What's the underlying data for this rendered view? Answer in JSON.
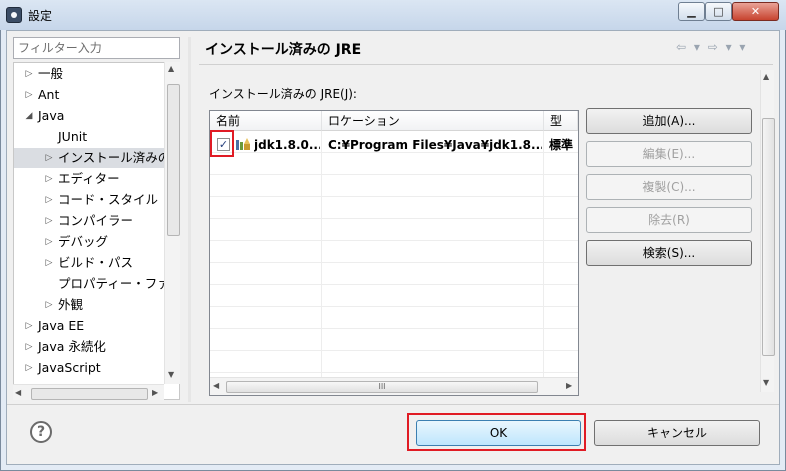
{
  "window": {
    "title": "設定"
  },
  "left": {
    "filter_placeholder": "フィルター入力",
    "tree": [
      {
        "label": "一般",
        "twisty": "▷",
        "level": 0
      },
      {
        "label": "Ant",
        "twisty": "▷",
        "level": 0
      },
      {
        "label": "Java",
        "twisty": "◢",
        "level": 0
      },
      {
        "label": "JUnit",
        "twisty": "",
        "level": 1
      },
      {
        "label": "インストール済みの",
        "twisty": "▷",
        "level": 1,
        "selected": true
      },
      {
        "label": "エディター",
        "twisty": "▷",
        "level": 1
      },
      {
        "label": "コード・スタイル",
        "twisty": "▷",
        "level": 1
      },
      {
        "label": "コンパイラー",
        "twisty": "▷",
        "level": 1
      },
      {
        "label": "デバッグ",
        "twisty": "▷",
        "level": 1
      },
      {
        "label": "ビルド・パス",
        "twisty": "▷",
        "level": 1
      },
      {
        "label": "プロパティー・ファ",
        "twisty": "",
        "level": 1
      },
      {
        "label": "外観",
        "twisty": "▷",
        "level": 1
      },
      {
        "label": "Java EE",
        "twisty": "▷",
        "level": 0
      },
      {
        "label": "Java 永続化",
        "twisty": "▷",
        "level": 0
      },
      {
        "label": "JavaScript",
        "twisty": "▷",
        "level": 0
      }
    ]
  },
  "page": {
    "title": "インストール済みの JRE",
    "nav": "⇦ ▾ ⇨ ▾ ▾",
    "jre_label": "インストール済みの JRE(J):",
    "table": {
      "headers": [
        "名前",
        "ロケーション",
        "型"
      ],
      "rows": [
        {
          "checked": true,
          "name": "jdk1.8.0...",
          "location": "C:¥Program Files¥Java¥jdk1.8...",
          "type": "標準"
        }
      ],
      "hscroll_glyph": "III"
    },
    "buttons": [
      {
        "label": "追加(A)...",
        "enabled": true
      },
      {
        "label": "編集(E)...",
        "enabled": false
      },
      {
        "label": "複製(C)...",
        "enabled": false
      },
      {
        "label": "除去(R)",
        "enabled": false
      },
      {
        "label": "検索(S)...",
        "enabled": true
      }
    ]
  },
  "dialog": {
    "help": "?",
    "ok": "OK",
    "cancel": "キャンセル"
  },
  "colors": {
    "highlight": "#e01b24",
    "selected": "#dadde2"
  }
}
